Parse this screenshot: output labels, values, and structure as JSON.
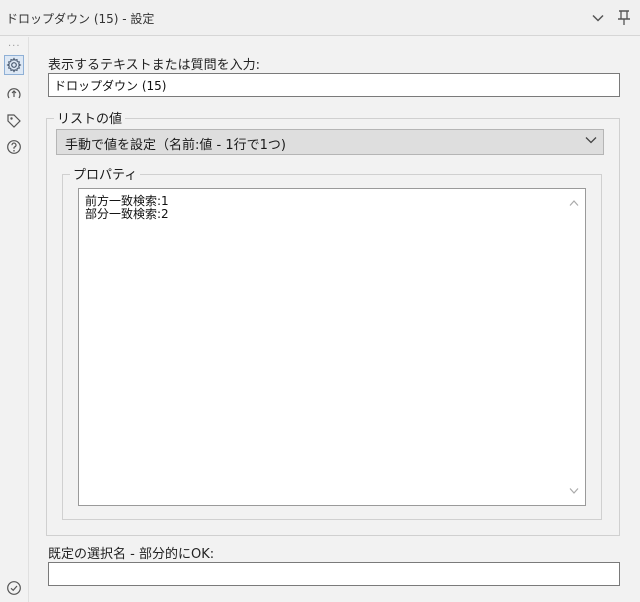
{
  "window": {
    "title": "ドロップダウン (15) - 設定",
    "collapse_icon": "chevron-down-icon",
    "pin_icon": "pin-icon"
  },
  "sidebar": {
    "more_dots": "...",
    "items": [
      {
        "icon": "gear-icon",
        "active": true
      },
      {
        "icon": "connection-icon",
        "active": false
      },
      {
        "icon": "tag-icon",
        "active": false
      },
      {
        "icon": "help-icon",
        "active": false
      },
      {
        "icon": "check-circle-icon",
        "active": false
      }
    ]
  },
  "form": {
    "question_label": "表示するテキストまたは質問を入力:",
    "question_value": "ドロップダウン (15)",
    "list_values_group": "リストの値",
    "list_mode_selected": "手動で値を設定（名前:値 - 1行で1つ)",
    "properties_group": "プロパティ",
    "properties_lines": [
      "前方一致検索:1",
      "部分一致検索:2"
    ],
    "default_label": "既定の選択名 - 部分的にOK:",
    "default_value": ""
  },
  "colors": {
    "background": "#f2f2f2",
    "active_icon_bg": "#dde8f5",
    "active_icon_border": "#8fb0d6",
    "select_bg": "#dedede"
  }
}
